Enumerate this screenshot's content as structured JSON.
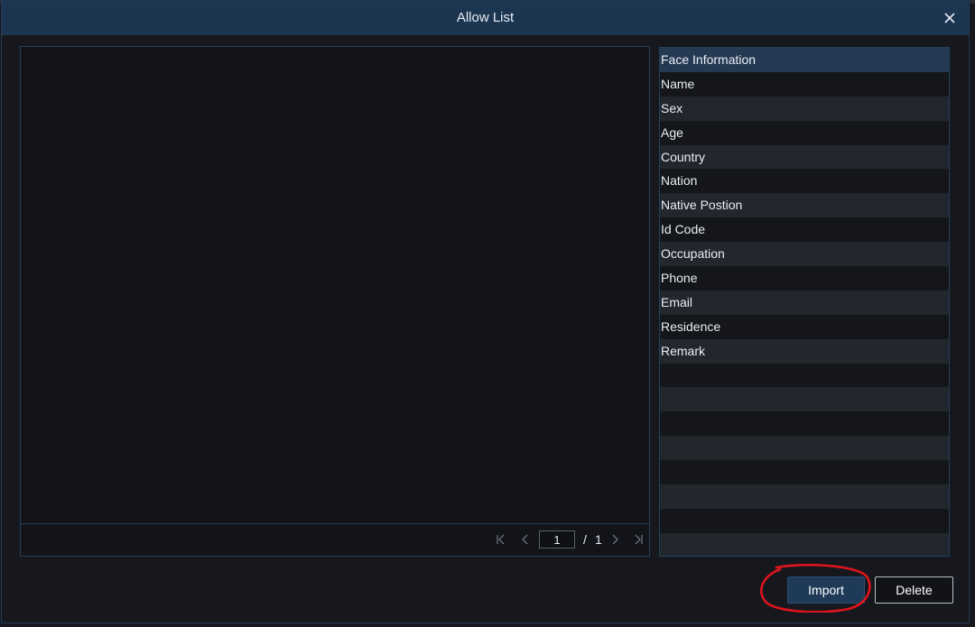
{
  "dialog": {
    "title": "Allow List",
    "close_icon": "close-icon"
  },
  "pager": {
    "current_page": "1",
    "separator": "/",
    "total_pages": "1",
    "icons": [
      "first-page-icon",
      "prev-page-icon",
      "next-page-icon",
      "last-page-icon"
    ]
  },
  "face_info": {
    "header": "Face Information",
    "fields": [
      "Name",
      "Sex",
      "Age",
      "Country",
      "Nation",
      "Native Postion",
      "Id Code",
      "Occupation",
      "Phone",
      "Email",
      "Residence",
      "Remark",
      "",
      "",
      "",
      "",
      "",
      "",
      "",
      ""
    ]
  },
  "actions": {
    "import_label": "Import",
    "delete_label": "Delete"
  },
  "colors": {
    "titlebar": "#1c3551",
    "background": "#16181d",
    "accent_border": "#22405e",
    "annotation": "#e0141c"
  }
}
